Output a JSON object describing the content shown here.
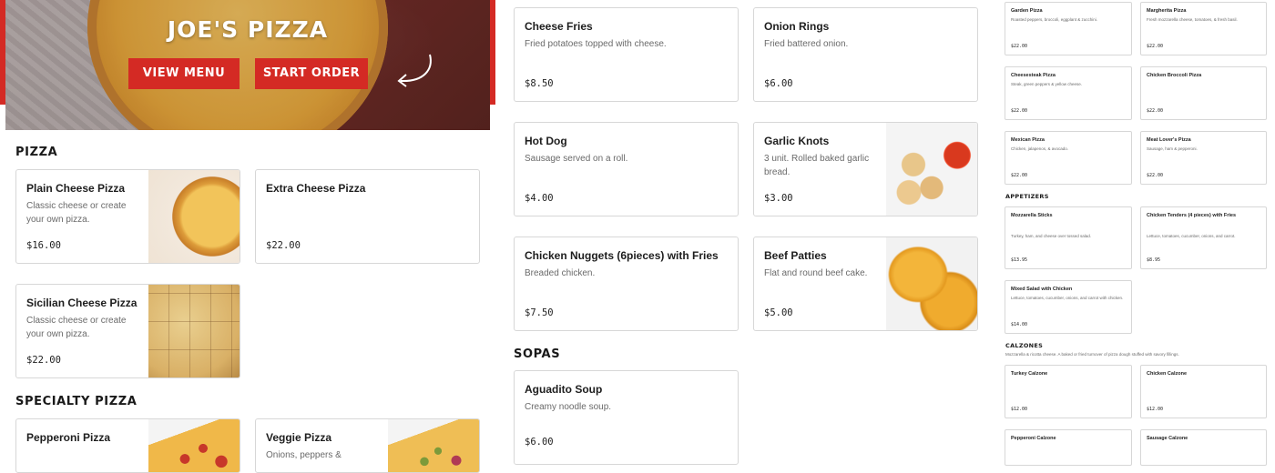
{
  "hero": {
    "title": "JOE'S PIZZA",
    "view_menu_label": "VIEW MENU",
    "start_order_label": "START ORDER",
    "accent_color": "#d42a24"
  },
  "sections": {
    "pizza": "PIZZA",
    "specialty_pizza": "SPECIALTY PIZZA",
    "sopas": "SOPAS"
  },
  "pizza_items": [
    {
      "name": "Plain Cheese Pizza",
      "desc1": "Classic cheese or create",
      "desc2": "your own pizza.",
      "price": "$16.00"
    },
    {
      "name": "Extra Cheese Pizza",
      "price": "$22.00"
    },
    {
      "name": "Sicilian Cheese Pizza",
      "desc1": "Classic cheese or create",
      "desc2": "your own pizza.",
      "price": "$22.00"
    }
  ],
  "specialty_items": [
    {
      "name": "Pepperoni Pizza"
    },
    {
      "name": "Veggie Pizza",
      "desc1": "Onions, peppers &"
    }
  ],
  "middle_items": [
    {
      "name": "Cheese Fries",
      "desc1": "Fried potatoes topped with cheese.",
      "price": "$8.50"
    },
    {
      "name": "Onion Rings",
      "desc1": "Fried battered onion.",
      "price": "$6.00"
    },
    {
      "name": "Hot Dog",
      "desc1": "Sausage served on a roll.",
      "price": "$4.00"
    },
    {
      "name": "Garlic Knots",
      "desc1": "3 unit. Rolled baked garlic",
      "desc2": "bread.",
      "price": "$3.00"
    },
    {
      "name": "Chicken Nuggets (6pieces) with Fries",
      "desc1": "Breaded chicken.",
      "price": "$7.50"
    },
    {
      "name": "Beef Patties",
      "desc1": "Flat and round beef cake.",
      "price": "$5.00"
    }
  ],
  "sopas_items": [
    {
      "name": "Aguadito Soup",
      "desc1": "Creamy noodle soup.",
      "price": "$6.00"
    }
  ],
  "right_column": {
    "specialty_cards": [
      {
        "name": "Garden Pizza",
        "desc": "Roasted peppers, broccoli, eggplant & zucchini.",
        "price": "$22.00"
      },
      {
        "name": "Margherita Pizza",
        "desc": "Fresh mozzarella cheese, tomatoes, & fresh basil.",
        "price": "$22.00"
      },
      {
        "name": "Cheesesteak Pizza",
        "desc": "Steak, green peppers & yellow cheese.",
        "price": "$22.00"
      },
      {
        "name": "Chicken Broccoli Pizza",
        "desc": "",
        "price": "$22.00"
      },
      {
        "name": "Mexican Pizza",
        "desc": "Chicken, jalapenos, & avocado.",
        "price": "$22.00"
      },
      {
        "name": "Meat Lover's Pizza",
        "desc": "Sausage, ham & pepperoni.",
        "price": "$22.00"
      }
    ],
    "appetizers_title": "APPETIZERS",
    "appetizer_cards": [
      {
        "name": "Mozzarella Sticks",
        "desc": "Turkey, ham, and cheese over tossed salad.",
        "price": "$13.95"
      },
      {
        "name": "Chicken Tenders (4 pieces) with Fries",
        "desc": "Lettuce, tomatoes, cucumber, onions, and carrot.",
        "price": "$8.95"
      },
      {
        "name": "Mixed Salad with Chicken",
        "desc": "Lettuce, tomatoes, cucumber, onions, and carrot with chicken.",
        "price": "$14.00"
      }
    ],
    "calzones_title": "CALZONES",
    "calzones_desc": "Mozzarella & ricotta cheese. A baked or fried turnover of pizza dough stuffed with savory fillings.",
    "calzone_cards": [
      {
        "name": "Turkey Calzone",
        "price": "$12.00"
      },
      {
        "name": "Chicken Calzone",
        "price": "$12.00"
      },
      {
        "name": "Pepperoni Calzone"
      },
      {
        "name": "Sausage Calzone"
      }
    ]
  }
}
